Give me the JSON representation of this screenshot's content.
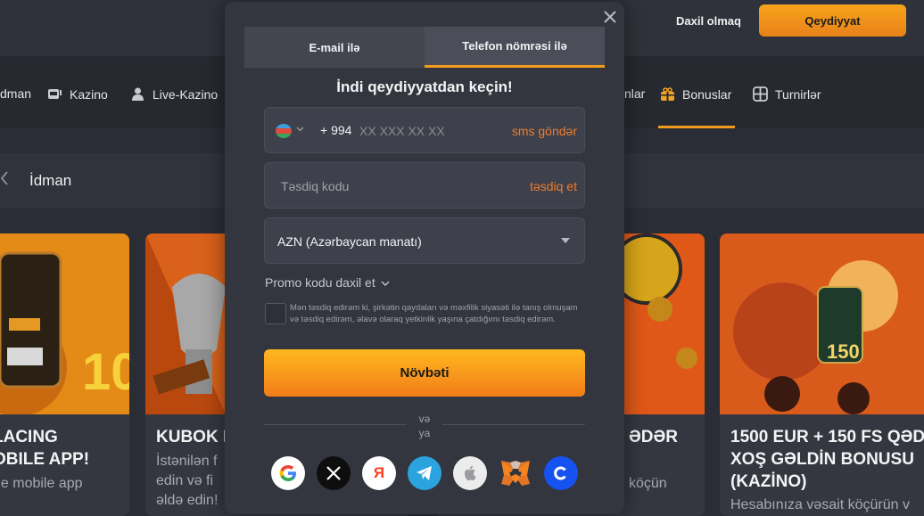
{
  "header": {
    "login_label": "Daxil olmaq",
    "register_label": "Qeydiyyat"
  },
  "nav": {
    "items": [
      {
        "label": "dman",
        "icon": "sports-icon"
      },
      {
        "label": "Kazino",
        "icon": "slot-machine-icon"
      },
      {
        "label": "Live-Kazino",
        "icon": "dealer-icon"
      },
      {
        "label": "nlar",
        "icon": ""
      },
      {
        "label": "Bonuslar",
        "icon": "gift-icon"
      },
      {
        "label": "Turnirlər",
        "icon": "tournament-icon"
      }
    ]
  },
  "section": {
    "title": "İdman"
  },
  "cards": [
    {
      "title_line1": "LACING",
      "title_line2": "OBILE APP!",
      "desc": "he mobile app"
    },
    {
      "title_line1": "KUBOK K",
      "title_line2": "",
      "desc_line1": "İstənilən f",
      "desc_line2": "edin və fi",
      "desc_line3": "əldə edin!"
    },
    {
      "title_line1": "ƏDƏR",
      "title_line2": "",
      "desc": "köçün"
    },
    {
      "title_line1": "1500 EUR + 150 FS QƏDƏ",
      "title_line2": "XOŞ GƏLDİN BONUSU",
      "title_line3": "(KAZİNO)",
      "desc": "Hesabınıza vəsait köçürün v"
    }
  ],
  "modal": {
    "tabs": [
      {
        "label": "E-mail ilə",
        "active": false
      },
      {
        "label": "Telefon nömrəsi ilə",
        "active": true
      }
    ],
    "heading": "İndi qeydiyyatdan keçin!",
    "phone": {
      "dial_code": "+ 994",
      "placeholder": "XX XXX XX XX",
      "action": "sms göndər"
    },
    "confirm": {
      "placeholder": "Təsdiq kodu",
      "action": "təsdiq et"
    },
    "currency": {
      "value": "AZN (Azərbaycan manatı)"
    },
    "promo_label": "Promo kodu daxil et",
    "terms": "Mən təsdiq edirəm ki, şirkətin qaydaları və məxfilik siyasəti ilə tanış olmuşam və təsdiq edirəm, əlavə olaraq yetkinlik yaşına çatdığımı təsdiq edirəm.",
    "next_label": "Növbəti",
    "or_label_1": "və",
    "or_label_2": "ya",
    "socials": [
      "google-icon",
      "x-icon",
      "yandex-icon",
      "telegram-icon",
      "apple-icon",
      "metamask-icon",
      "coinbase-icon"
    ],
    "yandex_letter": "Я"
  },
  "colors": {
    "accent": "#f29b1d",
    "action_text": "#f07b2c",
    "modal_bg": "#33363f"
  }
}
